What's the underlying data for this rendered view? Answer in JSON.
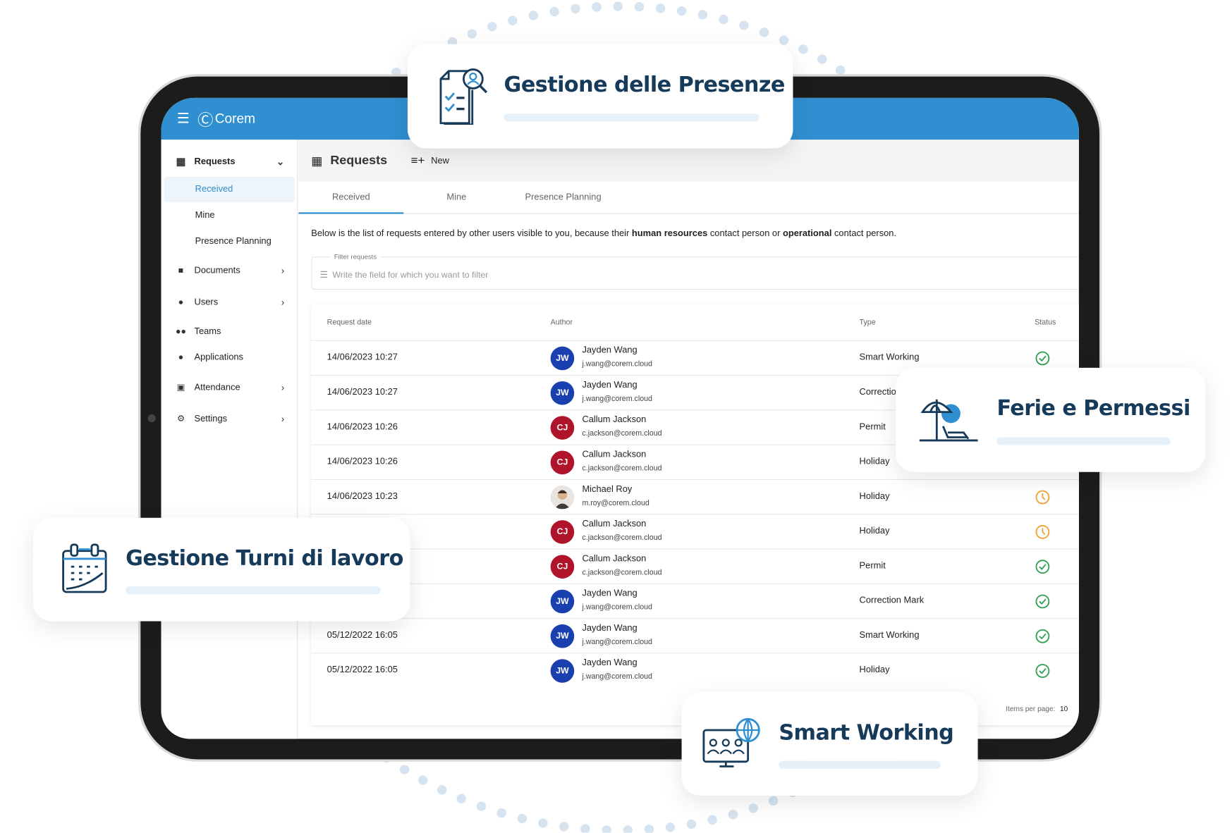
{
  "app": {
    "logo": "Corem"
  },
  "sidebar": {
    "requests": "Requests",
    "sub": [
      {
        "label": "Received",
        "active": true
      },
      {
        "label": "Mine"
      },
      {
        "label": "Presence Planning"
      }
    ],
    "items": [
      {
        "label": "Documents",
        "icon": "folder-icon"
      },
      {
        "label": "Users",
        "icon": "user-icon"
      },
      {
        "label": "Teams",
        "icon": "team-icon"
      },
      {
        "label": "Applications",
        "icon": "user-search-icon"
      },
      {
        "label": "Attendance",
        "icon": "badge-icon"
      },
      {
        "label": "Settings",
        "icon": "gear-icon"
      }
    ]
  },
  "toolbar": {
    "title": "Requests",
    "new_label": "New"
  },
  "tabs": [
    {
      "label": "Received",
      "active": true
    },
    {
      "label": "Mine"
    },
    {
      "label": "Presence Planning"
    }
  ],
  "description": {
    "p1": "Below is the list of requests entered by other users visible to you, because their ",
    "b1": "human resources",
    "p2": " contact person or ",
    "b2": "operational",
    "p3": " contact person."
  },
  "filter": {
    "label": "Filter requests",
    "placeholder": "Write the field for which you want to filter"
  },
  "table": {
    "headers": [
      "Request date",
      "Author",
      "Type",
      "Status"
    ],
    "rows": [
      {
        "date": "14/06/2023 10:27",
        "initials": "JW",
        "name": "Jayden Wang",
        "email": "j.wang@corem.cloud",
        "type": "Smart Working",
        "status": "approved"
      },
      {
        "date": "14/06/2023 10:27",
        "initials": "JW",
        "name": "Jayden Wang",
        "email": "j.wang@corem.cloud",
        "type": "Correction Mark",
        "status": "approved"
      },
      {
        "date": "14/06/2023 10:26",
        "initials": "CJ",
        "name": "Callum Jackson",
        "email": "c.jackson@corem.cloud",
        "type": "Permit",
        "status": "approved"
      },
      {
        "date": "14/06/2023 10:26",
        "initials": "CJ",
        "name": "Callum Jackson",
        "email": "c.jackson@corem.cloud",
        "type": "Holiday",
        "status": "approved"
      },
      {
        "date": "14/06/2023 10:23",
        "initials": "",
        "name": "Michael Roy",
        "email": "m.roy@corem.cloud",
        "type": "Holiday",
        "status": "pending"
      },
      {
        "date": "",
        "initials": "CJ",
        "name": "Callum Jackson",
        "email": "c.jackson@corem.cloud",
        "type": "Holiday",
        "status": "pending"
      },
      {
        "date": "",
        "initials": "CJ",
        "name": "Callum Jackson",
        "email": "c.jackson@corem.cloud",
        "type": "Permit",
        "status": "approved"
      },
      {
        "date": "",
        "initials": "JW",
        "name": "Jayden Wang",
        "email": "j.wang@corem.cloud",
        "type": "Correction Mark",
        "status": "approved"
      },
      {
        "date": "05/12/2022 16:05",
        "initials": "JW",
        "name": "Jayden Wang",
        "email": "j.wang@corem.cloud",
        "type": "Smart Working",
        "status": "approved"
      },
      {
        "date": "05/12/2022 16:05",
        "initials": "JW",
        "name": "Jayden Wang",
        "email": "j.wang@corem.cloud",
        "type": "Holiday",
        "status": "approved"
      }
    ],
    "items_per_page_label": "Items per page:",
    "items_per_page": "10"
  },
  "features": [
    "Gestione delle Presenze",
    "Ferie e Permessi",
    "Gestione Turni di lavoro",
    "Smart Working"
  ],
  "colors": {
    "primary": "#2f8fd0",
    "jw": "#1a3fae",
    "cj": "#b0142a",
    "approved": "#2e9e4f",
    "pending": "#f0a030",
    "title": "#163a5a"
  }
}
